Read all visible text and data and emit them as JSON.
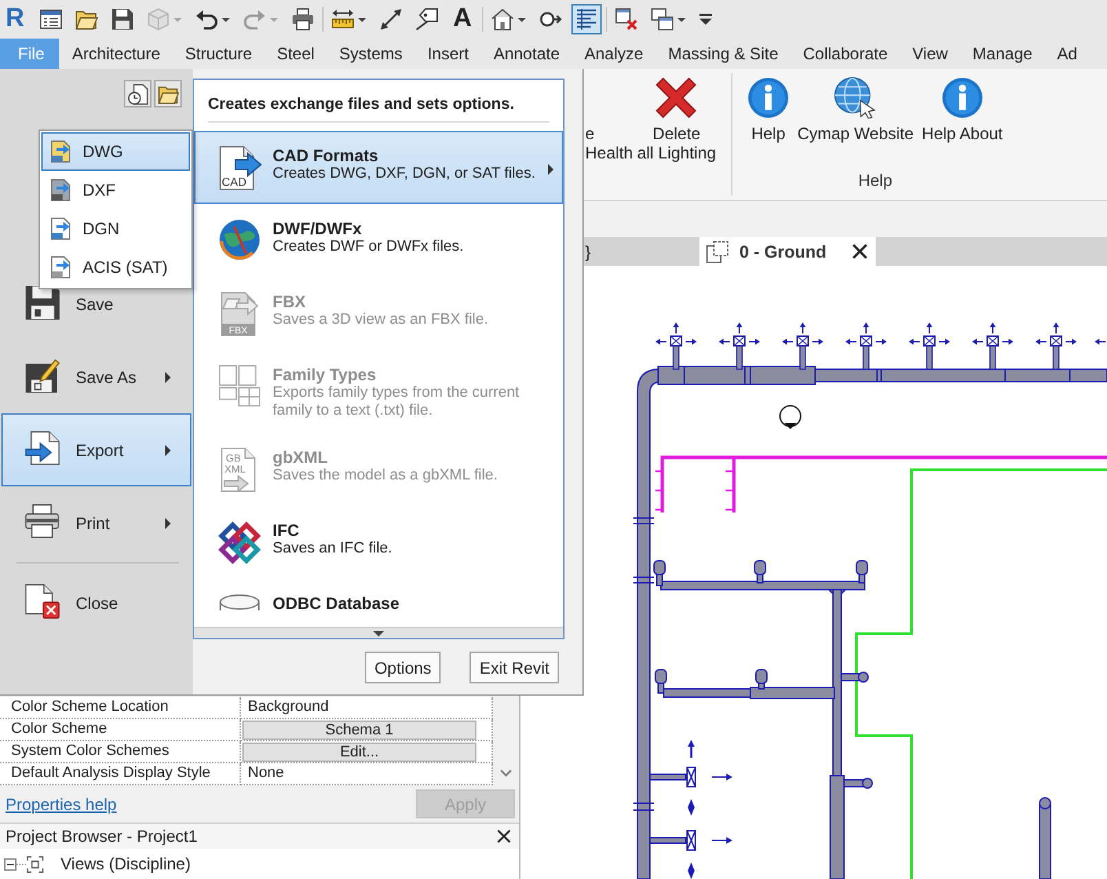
{
  "app_logo": "R",
  "quick_access_toolbar": [
    {
      "items": [
        {
          "kind": "properties",
          "dropdown": false,
          "disabled": false,
          "on": false
        },
        {
          "kind": "open",
          "dropdown": false,
          "disabled": false,
          "on": false
        },
        {
          "kind": "save",
          "dropdown": false,
          "disabled": false,
          "on": false
        },
        {
          "kind": "sync",
          "dropdown": true,
          "disabled": true,
          "on": false
        },
        {
          "kind": "undo",
          "dropdown": true,
          "disabled": false,
          "on": false
        },
        {
          "kind": "redo",
          "dropdown": true,
          "disabled": true,
          "on": false
        },
        {
          "kind": "print",
          "dropdown": false,
          "disabled": false,
          "on": false
        }
      ]
    },
    {
      "items": [
        {
          "kind": "measure",
          "dropdown": true,
          "disabled": false,
          "on": false
        },
        {
          "kind": "dimension",
          "dropdown": false,
          "disabled": false,
          "on": false
        },
        {
          "kind": "tag",
          "dropdown": false,
          "disabled": false,
          "on": false
        },
        {
          "kind": "text",
          "glyph": "A",
          "dropdown": false,
          "disabled": false,
          "on": false
        }
      ]
    },
    {
      "items": [
        {
          "kind": "view3d",
          "dropdown": true,
          "disabled": false,
          "on": false
        },
        {
          "kind": "section",
          "dropdown": false,
          "disabled": false,
          "on": false
        },
        {
          "kind": "thin_lines",
          "dropdown": false,
          "disabled": false,
          "on": true
        }
      ]
    },
    {
      "items": [
        {
          "kind": "close_hidden",
          "dropdown": false,
          "disabled": false,
          "on": false
        },
        {
          "kind": "switch_windows",
          "dropdown": true,
          "disabled": false,
          "on": false
        },
        {
          "kind": "customize",
          "dropdown": false,
          "disabled": false,
          "on": false
        }
      ]
    }
  ],
  "ribbon_tabs": [
    {
      "label": "File",
      "selected": true
    },
    {
      "label": "Architecture",
      "selected": false
    },
    {
      "label": "Structure",
      "selected": false
    },
    {
      "label": "Steel",
      "selected": false
    },
    {
      "label": "Systems",
      "selected": false
    },
    {
      "label": "Insert",
      "selected": false
    },
    {
      "label": "Annotate",
      "selected": false
    },
    {
      "label": "Analyze",
      "selected": false
    },
    {
      "label": "Massing & Site",
      "selected": false
    },
    {
      "label": "Collaborate",
      "selected": false
    },
    {
      "label": "View",
      "selected": false
    },
    {
      "label": "Manage",
      "selected": false
    },
    {
      "label": "Ad",
      "selected": false
    }
  ],
  "ribbon": {
    "panels": [
      {
        "buttons": [
          {
            "kind": "cut",
            "lines": [
              "e",
              "Health"
            ]
          },
          {
            "kind": "delete",
            "lines": [
              "Delete",
              "all Lighting"
            ]
          }
        ]
      },
      {
        "title": "Help",
        "buttons": [
          {
            "kind": "info",
            "lines": [
              "Help"
            ]
          },
          {
            "kind": "globe",
            "lines": [
              "Cymap Website"
            ]
          },
          {
            "kind": "info",
            "lines": [
              "Help About"
            ]
          }
        ]
      }
    ]
  },
  "application_menu": {
    "command_groups": [
      {
        "commands": [
          {
            "kind": "save",
            "label": "Save",
            "submenu": false,
            "selected": false
          },
          {
            "kind": "save_as",
            "label": "Save As",
            "submenu": true,
            "selected": false
          },
          {
            "kind": "export",
            "label": "Export",
            "submenu": true,
            "selected": true
          },
          {
            "kind": "print",
            "label": "Print",
            "submenu": true,
            "selected": false
          }
        ]
      },
      {
        "commands": [
          {
            "kind": "close",
            "label": "Close",
            "submenu": false,
            "selected": false
          }
        ]
      }
    ],
    "export_panel": {
      "heading": "Creates exchange files and sets options.",
      "items": [
        {
          "kind": "cad",
          "icon_text": [
            "CAD"
          ],
          "title": "CAD Formats",
          "description": "Creates DWG, DXF, DGN, or SAT files.",
          "selected": true,
          "disabled": false,
          "submenu": true
        },
        {
          "kind": "dwf",
          "title": "DWF/DWFx",
          "description": "Creates DWF or DWFx files.",
          "selected": false,
          "disabled": false,
          "submenu": false
        },
        {
          "kind": "fbx",
          "icon_text": [
            "FBX"
          ],
          "title": "FBX",
          "description": "Saves a 3D view as an FBX file.",
          "selected": false,
          "disabled": true,
          "submenu": false
        },
        {
          "kind": "family_types",
          "title": "Family Types",
          "description": "Exports family types from the current family to a text (.txt) file.",
          "selected": false,
          "disabled": true,
          "submenu": false
        },
        {
          "kind": "gbxml",
          "icon_text": [
            "GB",
            "XML"
          ],
          "title": "gbXML",
          "description": "Saves the model as a gbXML file.",
          "selected": false,
          "disabled": true,
          "submenu": false
        },
        {
          "kind": "ifc",
          "title": "IFC",
          "description": "Saves an IFC file.",
          "selected": false,
          "disabled": false,
          "submenu": false
        },
        {
          "kind": "database",
          "title": "ODBC Database",
          "selected": false,
          "disabled": false,
          "submenu": false
        }
      ]
    },
    "cad_formats_flyout": [
      {
        "kind": "dwg",
        "label": "DWG",
        "selected": true
      },
      {
        "kind": "dxf",
        "label": "DXF",
        "selected": false
      },
      {
        "kind": "dgn",
        "label": "DGN",
        "selected": false
      },
      {
        "kind": "sat",
        "label": "ACIS (SAT)",
        "selected": false
      }
    ],
    "buttons": [
      {
        "label": "Options"
      },
      {
        "label": "Exit Revit"
      }
    ]
  },
  "view_tabs": [
    {
      "kind": "cut",
      "label": "}",
      "selected": false
    },
    {
      "kind": "full",
      "label": "0 - Ground",
      "selected": true
    }
  ],
  "properties": {
    "rows": [
      {
        "label": "Color Scheme Location",
        "kind": "text",
        "value": "Background"
      },
      {
        "label": "Color Scheme",
        "kind": "button",
        "value": "Schema 1"
      },
      {
        "label": "System Color Schemes",
        "kind": "button",
        "value": "Edit..."
      },
      {
        "label": "Default Analysis Display Style",
        "kind": "text",
        "value": "None"
      }
    ],
    "help_link": "Properties help",
    "apply": {
      "label": "Apply",
      "disabled": true
    }
  },
  "project_browser": {
    "title": "Project Browser - Project1",
    "tree": [
      {
        "label": "Views (Discipline)",
        "expanded": true
      }
    ]
  }
}
